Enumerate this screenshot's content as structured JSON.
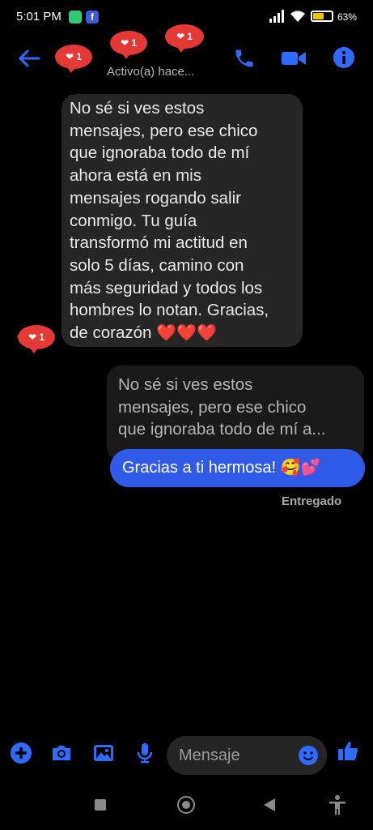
{
  "status_bar": {
    "time": "5:01 PM",
    "battery": "63",
    "battery_level_percent": 63
  },
  "header": {
    "active_status": "Activo(a) hace..."
  },
  "reactions": [
    {
      "count": "1"
    },
    {
      "count": "1"
    },
    {
      "count": "1"
    },
    {
      "count": "1"
    }
  ],
  "messages": {
    "received": {
      "lines": [
        "No sé si ves estos",
        "mensajes, pero ese chico",
        "que ignoraba todo de mí",
        "ahora está en mis",
        "mensajes rogando salir",
        "conmigo. Tu guía",
        "transformó mi actitud en",
        "solo 5 días, camino con",
        "más seguridad y todos los",
        "hombres lo notan. Gracias,",
        "de corazón"
      ],
      "hearts": "❤️❤️❤️"
    },
    "reply_quote_lines": [
      "No sé si ves estos",
      "mensajes, pero ese chico",
      "que ignoraba todo de mí a..."
    ],
    "sent": {
      "text": "Gracias a ti hermosa!",
      "emoji": "🥰💕"
    },
    "delivery_status": "Entregado"
  },
  "composer": {
    "placeholder": "Mensaje"
  },
  "colors": {
    "accent": "#2f6bff",
    "sent_bubble": "#2f5be8",
    "received_bubble": "#262626",
    "reaction": "#e53935"
  },
  "icons": [
    "back-arrow-icon",
    "phone-icon",
    "video-icon",
    "info-icon",
    "plus-icon",
    "camera-icon",
    "image-icon",
    "microphone-icon",
    "emoji-icon",
    "thumbs-up-icon"
  ]
}
